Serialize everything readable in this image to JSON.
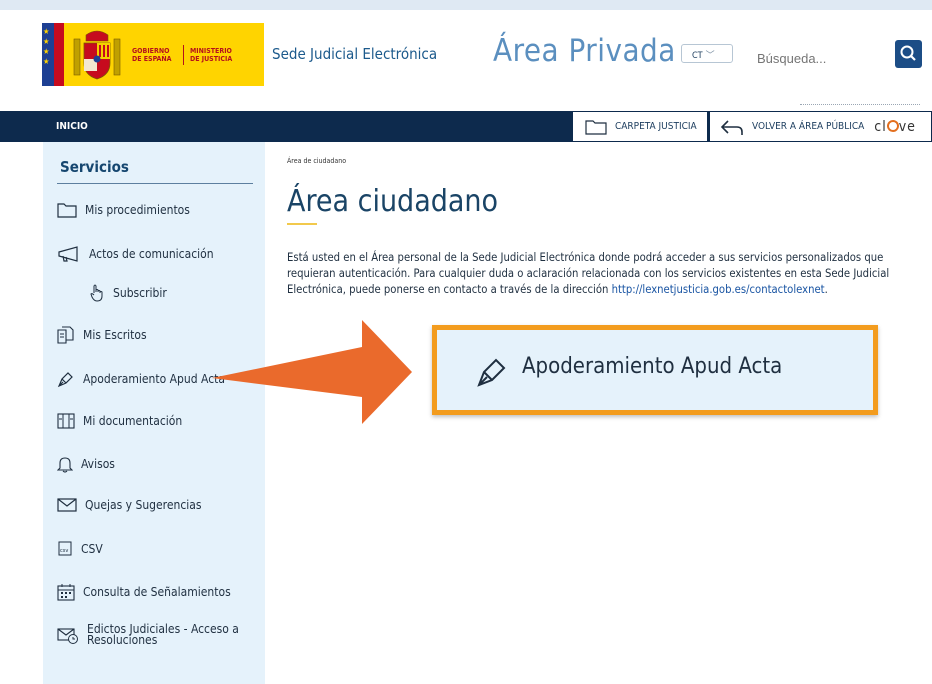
{
  "header": {
    "sede_title": "Sede Judicial Electrónica",
    "area_title": "Área Privada",
    "language": "CT",
    "search_placeholder": "Búsqueda...",
    "logo": {
      "gobierno": "GOBIERNO\nDE ESPAÑA",
      "ministerio": "MINISTERIO\nDE JUSTICIA"
    }
  },
  "navbar": {
    "home": "INICIO",
    "carpeta": "CARPETA JUSTICIA",
    "volver": "VOLVER A ÁREA PÚBLICA",
    "clave": "clave"
  },
  "sidebar": {
    "title": "Servicios",
    "items": [
      {
        "label": "Mis procedimientos",
        "icon": "folder-icon"
      },
      {
        "label": "Actos de comunicación",
        "icon": "megaphone-icon"
      },
      {
        "label": "Subscribir",
        "icon": "pointer-hand-icon"
      },
      {
        "label": "Mis Escritos",
        "icon": "documents-icon"
      },
      {
        "label": "Apoderamiento Apud Acta",
        "icon": "pen-icon"
      },
      {
        "label": "Mi documentación",
        "icon": "binder-icon"
      },
      {
        "label": "Avisos",
        "icon": "bell-icon"
      },
      {
        "label": "Quejas y Sugerencias",
        "icon": "envelope-icon"
      },
      {
        "label": "CSV",
        "icon": "csv-icon"
      },
      {
        "label": "Consulta de Señalamientos",
        "icon": "calendar-icon"
      },
      {
        "label": "Edictos Judiciales - Acceso a Resoluciones",
        "icon": "envelope-clock-icon"
      }
    ]
  },
  "main": {
    "breadcrumb": "Área de ciudadano",
    "title": "Área ciudadano",
    "intro": "Está usted en el Área personal de la Sede Judicial Electrónica donde podrá acceder a sus servicios personalizados que requieran autenticación. Para cualquier duda o aclaración relacionada con los servicios existentes en esta Sede Judicial Electrónica, puede ponerse en contacto a través de la dirección ",
    "link": "http://lexnetjusticia.gob.es/contactolexnet",
    "link_suffix": "."
  },
  "callout": {
    "label": "Apoderamiento Apud Acta"
  },
  "colors": {
    "navbar": "#0d2a4d",
    "sidebar": "#e5f2fb",
    "accent": "#f39c1e",
    "arrow": "#ea6a2c"
  }
}
